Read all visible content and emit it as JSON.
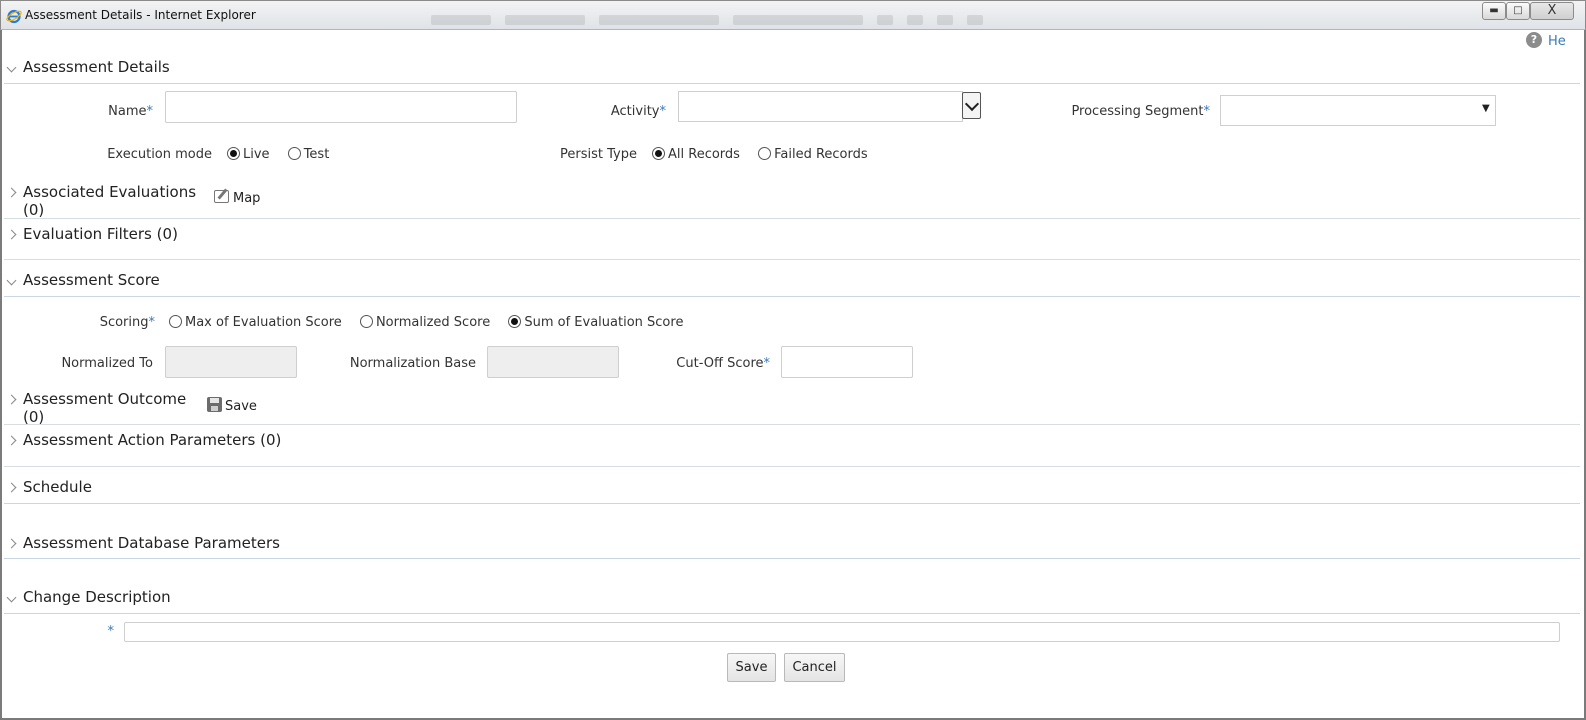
{
  "window": {
    "title": "Assessment Details - Internet Explorer",
    "close_glyph": "X"
  },
  "help": {
    "icon_glyph": "?",
    "label": "He"
  },
  "sections": {
    "assessment_details": "Assessment Details",
    "associated_evaluations": "Associated Evaluations",
    "associated_evaluations_count": "(0)",
    "evaluation_filters": "Evaluation Filters",
    "evaluation_filters_count": "(0)",
    "assessment_score": "Assessment Score",
    "assessment_outcome": "Assessment Outcome",
    "assessment_outcome_count": "(0)",
    "assessment_action_parameters": "Assessment Action Parameters",
    "assessment_action_parameters_count": "(0)",
    "schedule": "Schedule",
    "assessment_database_parameters": "Assessment Database Parameters",
    "change_description": "Change Description"
  },
  "actions": {
    "map": "Map",
    "save": "Save"
  },
  "details_form": {
    "name_label": "Name",
    "name_value": "",
    "activity_label": "Activity",
    "activity_value": "",
    "processing_segment_label": "Processing Segment",
    "processing_segment_value": "",
    "required_mark": "*",
    "execution_mode_label": "Execution mode",
    "execution_mode_options": [
      "Live",
      "Test"
    ],
    "execution_mode_selected": "Live",
    "persist_type_label": "Persist Type",
    "persist_type_options": [
      "All Records",
      "Failed Records"
    ],
    "persist_type_selected": "All Records"
  },
  "score_form": {
    "scoring_label": "Scoring",
    "scoring_options": [
      "Max of Evaluation Score",
      "Normalized Score",
      "Sum of Evaluation Score"
    ],
    "scoring_selected": "Sum of Evaluation Score",
    "normalized_to_label": "Normalized To",
    "normalized_to_value": "",
    "normalization_base_label": "Normalization Base",
    "normalization_base_value": "",
    "cutoff_score_label": "Cut-Off Score",
    "cutoff_score_value": ""
  },
  "change_description": {
    "required_mark": "*",
    "value": ""
  },
  "footer_buttons": {
    "save": "Save",
    "cancel": "Cancel"
  }
}
